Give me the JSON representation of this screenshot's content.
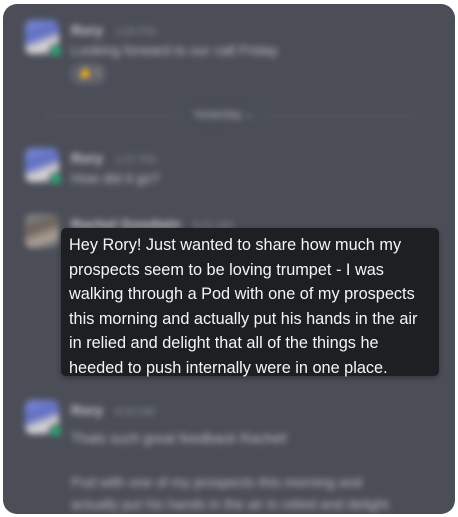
{
  "conversation": {
    "messages": [
      {
        "sender": "Rory",
        "time": "1:05 PM",
        "text": "Looking forward to our call Friday",
        "reaction": "👍 1"
      },
      {
        "sender": "Rory",
        "time": "1:07 PM",
        "text": "How did it go?"
      },
      {
        "sender": "Rachel Goodwin",
        "time": "9:41 AM"
      },
      {
        "sender": "Rory",
        "time": "9:43 AM",
        "text_lines": [
          "Thats such great feedback Rachel!",
          "",
          "Pod with one of my prospects this morning and",
          "actually put his hands in the air in relied and delight"
        ]
      }
    ],
    "divider_label": "Yesterday ⌄"
  },
  "tooltip": {
    "text": "Hey Rory! Just wanted to share how much my prospects seem to be loving trumpet - I was walking through a Pod with one of my prospects this morning and actually put his hands in the air in relied and delight that all of the things he heeded to push internally were in one place."
  },
  "colors": {
    "background": "#4b4e57",
    "tooltip_bg": "#1d1f23",
    "tooltip_text": "#f4f5f6",
    "presence": "#2bac76"
  }
}
